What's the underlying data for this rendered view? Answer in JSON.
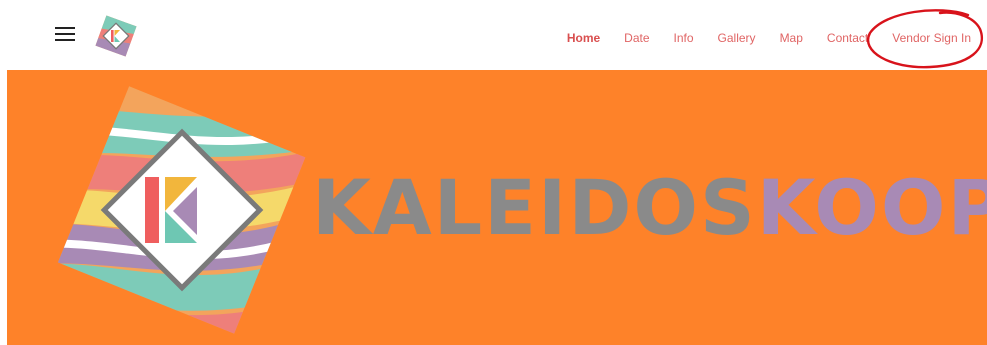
{
  "header": {
    "menu_icon": "hamburger-icon",
    "logo_icon": "kaleidoskoop-logo-icon"
  },
  "nav": {
    "items": [
      {
        "label": "Home",
        "active": true
      },
      {
        "label": "Date"
      },
      {
        "label": "Info"
      },
      {
        "label": "Gallery"
      },
      {
        "label": "Map"
      },
      {
        "label": "Contact"
      },
      {
        "label": "Vendor Sign In",
        "annotated": true
      }
    ]
  },
  "hero": {
    "wordmark_part1": "KALEIDOS",
    "wordmark_part2": "KOOP"
  },
  "colors": {
    "hero_background": "#fe8229",
    "nav_text": "#e06565",
    "annotation_circle": "#d8131b",
    "wordmark_gray": "#8a8a8a",
    "wordmark_purple": "#a88ab5"
  }
}
